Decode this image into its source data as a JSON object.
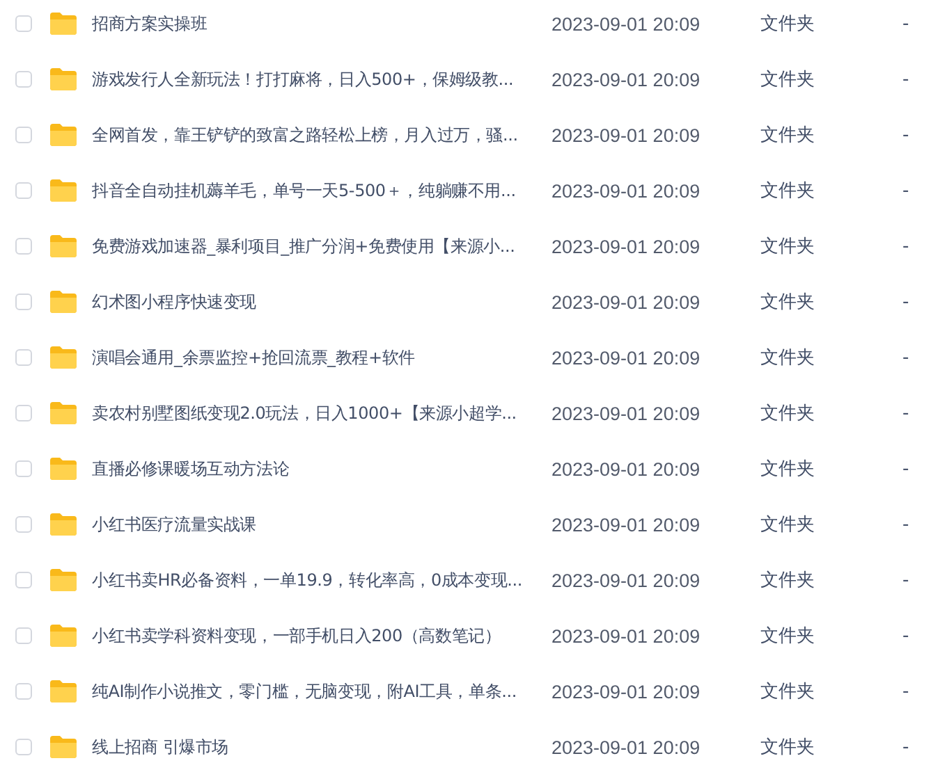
{
  "files": [
    {
      "name": "招商方案实操班",
      "modified": "2023-09-01 20:09",
      "type": "文件夹",
      "size": "-",
      "checked": false
    },
    {
      "name": "游戏发行人全新玩法！打打麻将，日入500+，保姆级教...",
      "modified": "2023-09-01 20:09",
      "type": "文件夹",
      "size": "-",
      "checked": false
    },
    {
      "name": "全网首发，靠王铲铲的致富之路轻松上榜，月入过万，骚...",
      "modified": "2023-09-01 20:09",
      "type": "文件夹",
      "size": "-",
      "checked": false
    },
    {
      "name": "抖音全自动挂机薅羊毛，单号一天5-500＋，纯躺赚不用...",
      "modified": "2023-09-01 20:09",
      "type": "文件夹",
      "size": "-",
      "checked": false
    },
    {
      "name": "免费游戏加速器_暴利项目_推广分润+免费使用【来源小...",
      "modified": "2023-09-01 20:09",
      "type": "文件夹",
      "size": "-",
      "checked": false
    },
    {
      "name": "幻术图小程序快速变现",
      "modified": "2023-09-01 20:09",
      "type": "文件夹",
      "size": "-",
      "checked": false
    },
    {
      "name": "演唱会通用_余票监控+抢回流票_教程+软件",
      "modified": "2023-09-01 20:09",
      "type": "文件夹",
      "size": "-",
      "checked": false
    },
    {
      "name": "卖农村别墅图纸变现2.0玩法，日入1000+【来源小超学...",
      "modified": "2023-09-01 20:09",
      "type": "文件夹",
      "size": "-",
      "checked": false
    },
    {
      "name": "直播必修课暖场互动方法论",
      "modified": "2023-09-01 20:09",
      "type": "文件夹",
      "size": "-",
      "checked": false
    },
    {
      "name": "小红书医疗流量实战课",
      "modified": "2023-09-01 20:09",
      "type": "文件夹",
      "size": "-",
      "checked": false
    },
    {
      "name": "小红书卖HR必备资料，一单19.9，转化率高，0成本变现...",
      "modified": "2023-09-01 20:09",
      "type": "文件夹",
      "size": "-",
      "checked": false
    },
    {
      "name": "小红书卖学科资料变现，一部手机日入200（高数笔记）",
      "modified": "2023-09-01 20:09",
      "type": "文件夹",
      "size": "-",
      "checked": false
    },
    {
      "name": "纯AI制作小说推文，零门槛，无脑变现，附AI工具，单条...",
      "modified": "2023-09-01 20:09",
      "type": "文件夹",
      "size": "-",
      "checked": false
    },
    {
      "name": "线上招商 引爆市场",
      "modified": "2023-09-01 20:09",
      "type": "文件夹",
      "size": "-",
      "checked": false
    }
  ]
}
